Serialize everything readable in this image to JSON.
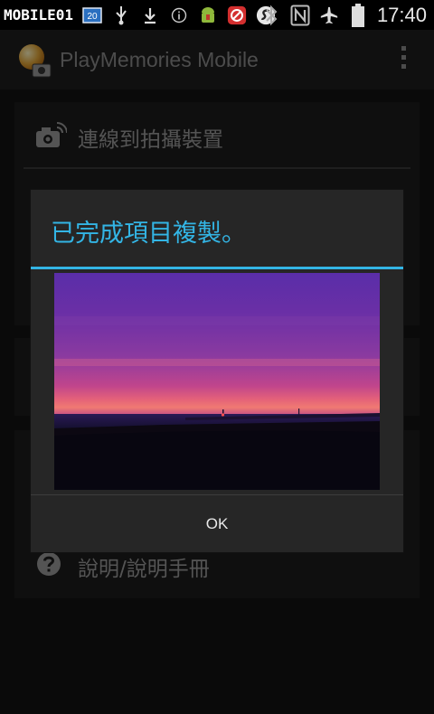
{
  "status_bar": {
    "watermark": "MOBILE01",
    "notification_badge": "20",
    "time": "17:40",
    "icons": [
      "image-icon",
      "sim-badge-icon",
      "usb-icon",
      "download-icon",
      "info-icon",
      "android-icon",
      "blocked-icon",
      "swipe-s-icon",
      "bluetooth-icon",
      "nfc-icon",
      "airplane-icon",
      "battery-icon"
    ]
  },
  "action_bar": {
    "title": "PlayMemories Mobile",
    "logo_icon": "playmemories-logo-icon",
    "overflow_icon": "overflow-menu-icon"
  },
  "menu": {
    "connect_label": "連線到拍攝裝置",
    "help_label": "說明/說明手冊"
  },
  "dialog": {
    "title": "已完成項目複製。",
    "ok_label": "OK",
    "photo_icon": "sunset-photo"
  },
  "colors": {
    "accent": "#33b5e5",
    "background": "#131313",
    "dialog": "#262626"
  }
}
